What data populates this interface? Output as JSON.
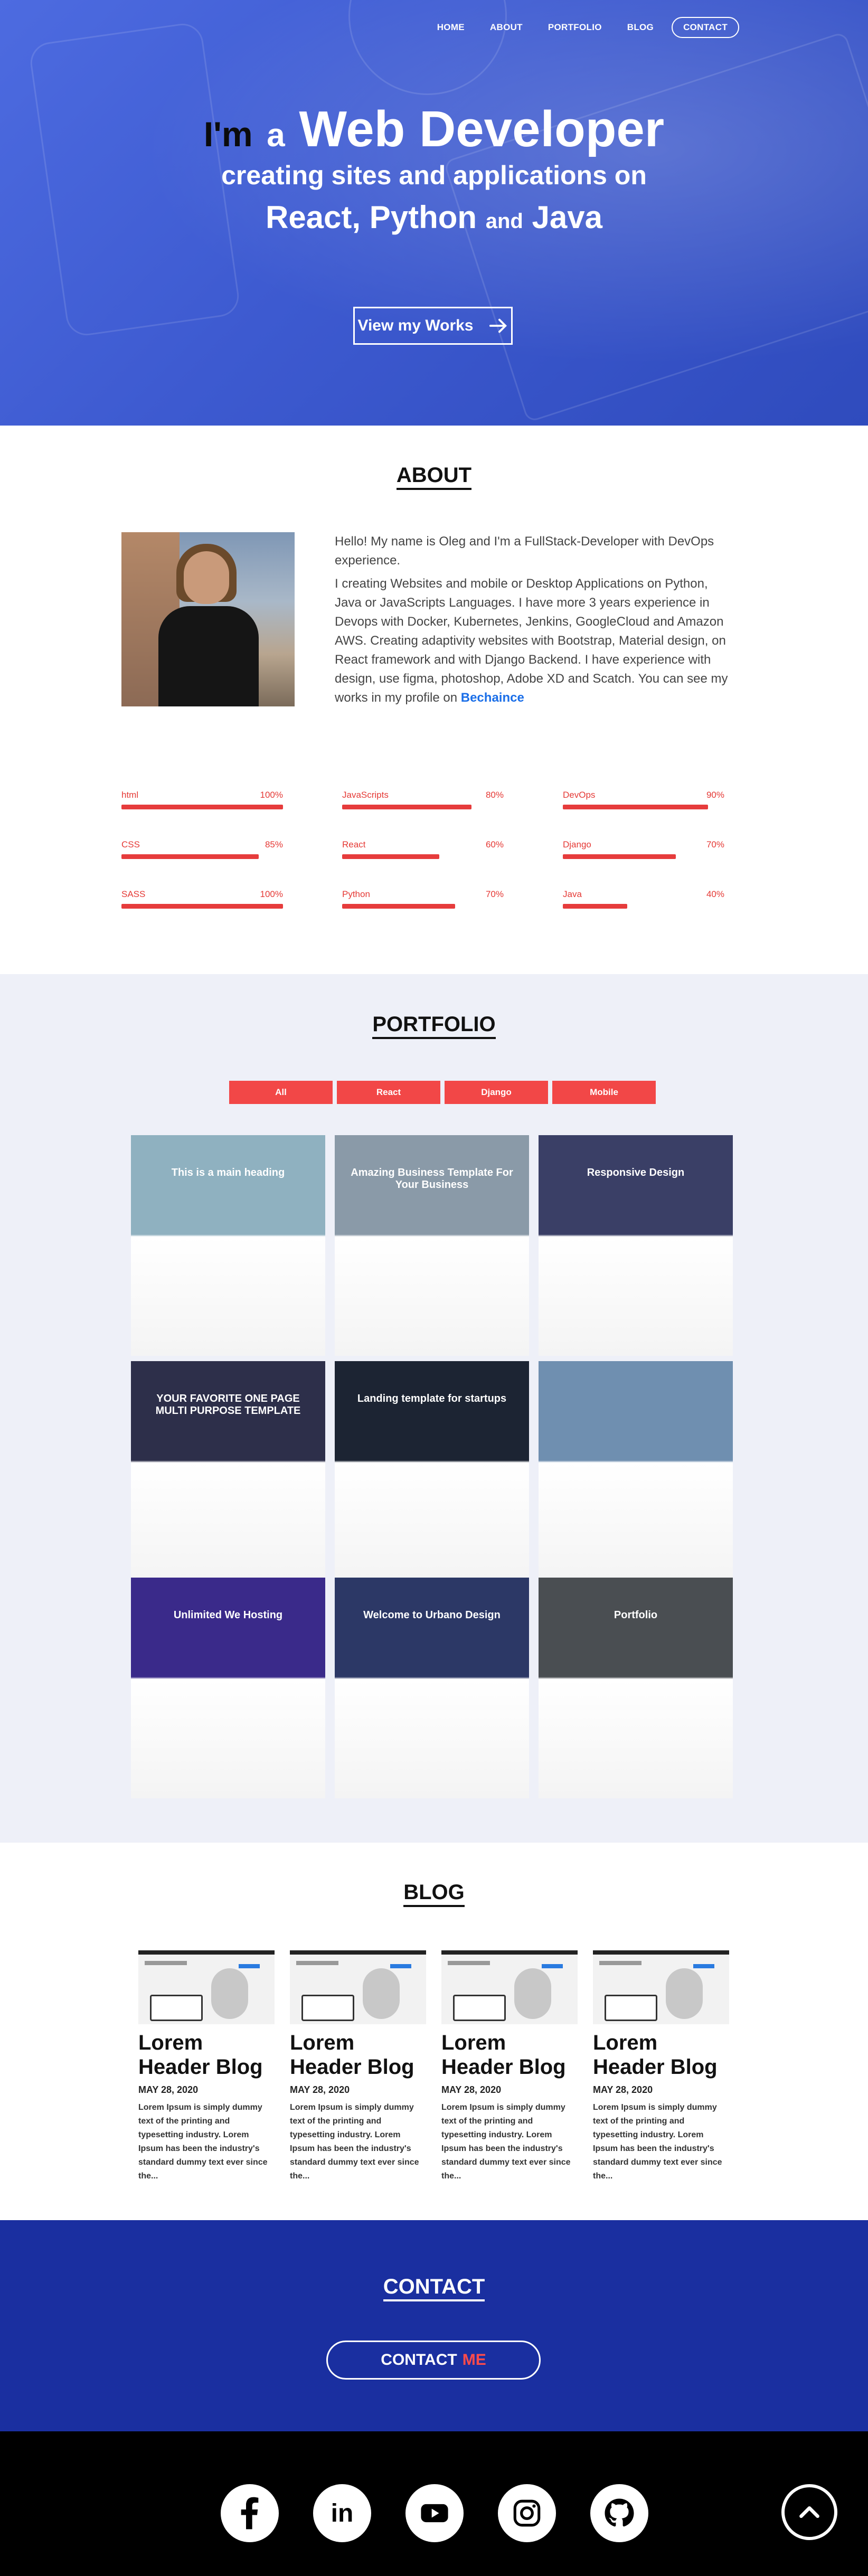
{
  "nav": {
    "items": [
      "HOME",
      "ABOUT",
      "PORTFOLIO",
      "BLOG"
    ],
    "contact": "CONTACT"
  },
  "hero": {
    "im": "I'm",
    "a": "a",
    "role": "Web Developer",
    "line2": "creating sites and applications on",
    "tech1": "React, Python",
    "and": "and",
    "tech2": "Java",
    "button": "View my Works"
  },
  "about": {
    "title": "ABOUT",
    "intro": "Hello! My name is Oleg and I'm a FullStack-Developer with DevOps experience.",
    "body": "I creating Websites and mobile or Desktop Applications on Python, Java or JavaScripts Languages. I have more 3 years experience in Devops with Docker, Kubernetes, Jenkins, GoogleCloud and Amazon AWS. Creating adaptivity websites with Bootstrap, Material design, on React framework and with Django Backend. I have experience with design, use figma, photoshop, Adobe XD and Scatch. You can see my works in my profile on",
    "link": "Bechaince",
    "skills": [
      {
        "name": "html",
        "percent": 100,
        "label": "100%"
      },
      {
        "name": "JavaScripts",
        "percent": 80,
        "label": "80%"
      },
      {
        "name": "DevOps",
        "percent": 90,
        "label": "90%"
      },
      {
        "name": "CSS",
        "percent": 85,
        "label": "85%"
      },
      {
        "name": "React",
        "percent": 60,
        "label": "60%"
      },
      {
        "name": "Django",
        "percent": 70,
        "label": "70%"
      },
      {
        "name": "SASS",
        "percent": 100,
        "label": "100%"
      },
      {
        "name": "Python",
        "percent": 70,
        "label": "70%"
      },
      {
        "name": "Java",
        "percent": 40,
        "label": "40%"
      }
    ]
  },
  "portfolio": {
    "title": "PORTFOLIO",
    "filters": [
      "All",
      "React",
      "Django",
      "Mobile"
    ],
    "tiles": [
      {
        "caption": "This is a main heading",
        "bg": "#8fb1c0"
      },
      {
        "caption": "Amazing Business Template For Your Business",
        "bg": "#8a9aa8"
      },
      {
        "caption": "Responsive Design",
        "bg": "#3a3f66"
      },
      {
        "caption": "YOUR FAVORITE ONE PAGE MULTI PURPOSE TEMPLATE",
        "bg": "#2d2f4a"
      },
      {
        "caption": "Landing template for startups",
        "bg": "#1c2433"
      },
      {
        "caption": "",
        "bg": "#6f8fb0"
      },
      {
        "caption": "Unlimited We Hosting",
        "bg": "#3a2a8a"
      },
      {
        "caption": "Welcome to Urbano Design",
        "bg": "#2c3866"
      },
      {
        "caption": "Portfolio",
        "bg": "#4a4e52"
      }
    ]
  },
  "blog": {
    "title": "BLOG",
    "posts": [
      {
        "title": "Lorem Header Blog",
        "date": "MAY 28, 2020",
        "text": "Lorem Ipsum is simply dummy text of the printing and typesetting industry. Lorem Ipsum has been the industry's standard dummy text ever since the..."
      },
      {
        "title": "Lorem Header Blog",
        "date": "MAY 28, 2020",
        "text": "Lorem Ipsum is simply dummy text of the printing and typesetting industry. Lorem Ipsum has been the industry's standard dummy text ever since the..."
      },
      {
        "title": "Lorem Header Blog",
        "date": "MAY 28, 2020",
        "text": "Lorem Ipsum is simply dummy text of the printing and typesetting industry. Lorem Ipsum has been the industry's standard dummy text ever since the..."
      },
      {
        "title": "Lorem Header Blog",
        "date": "MAY 28, 2020",
        "text": "Lorem Ipsum is simply dummy text of the printing and typesetting industry. Lorem Ipsum has been the industry's standard dummy text ever since the..."
      }
    ]
  },
  "contact": {
    "title": "CONTACT",
    "button": "CONTACT",
    "button_accent": "ME"
  },
  "footer": {
    "icons": [
      "facebook-icon",
      "linkedin-icon",
      "youtube-icon",
      "instagram-icon",
      "github-icon"
    ],
    "up_icon": "chevron-up-icon"
  },
  "colors": {
    "hero_blue": "#3d5ad0",
    "accent_red": "#f24747",
    "contact_blue": "#1a2fa0",
    "link_blue": "#1a6ee8"
  }
}
